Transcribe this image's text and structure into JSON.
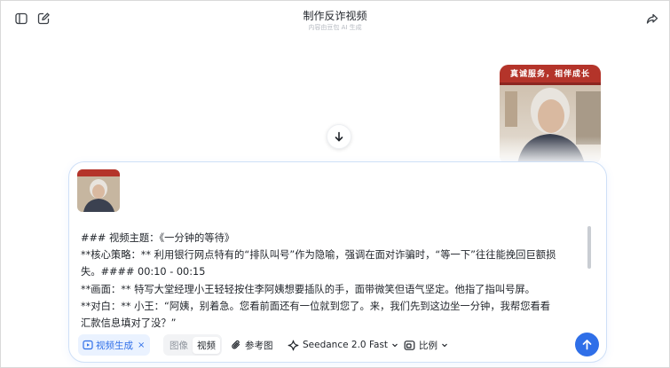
{
  "header": {
    "title": "制作反诈视频",
    "subtitle": "内容由豆包 AI 生成",
    "icons": [
      "sidebar-toggle-icon",
      "new-chat-icon",
      "share-icon"
    ]
  },
  "chat_image": {
    "banner_text": "真诚服务，相伴成长"
  },
  "composer": {
    "lines": [
      "### 视频主题：《一分钟的等待》",
      "**核心策略：** 利用银行网点特有的“排队叫号”作为隐喻，强调在面对诈骗时，“等一下”往往能挽回巨额损",
      "失。#### 00:10 - 00:15",
      "**画面：** 特写大堂经理小王轻轻按住李阿姨想要插队的手，面带微笑但语气坚定。他指了指叫号屏。",
      "**对白：** 小王：“阿姨，别着急。您看前面还有一位就到您了。来，我们先到这边坐一分钟，我帮您看看",
      "汇款信息填对了没？”"
    ],
    "toolbar": {
      "video_chip_label": "视频生成",
      "close_glyph": "×",
      "segment": [
        "图像",
        "视频"
      ],
      "reference_label": "参考图",
      "model_label": "Seedance 2.0 Fast",
      "ratio_label": "比例"
    }
  },
  "colors": {
    "accent": "#2f6fe8",
    "chip_bg": "#eaf2ff",
    "border": "#cfe0f7"
  }
}
